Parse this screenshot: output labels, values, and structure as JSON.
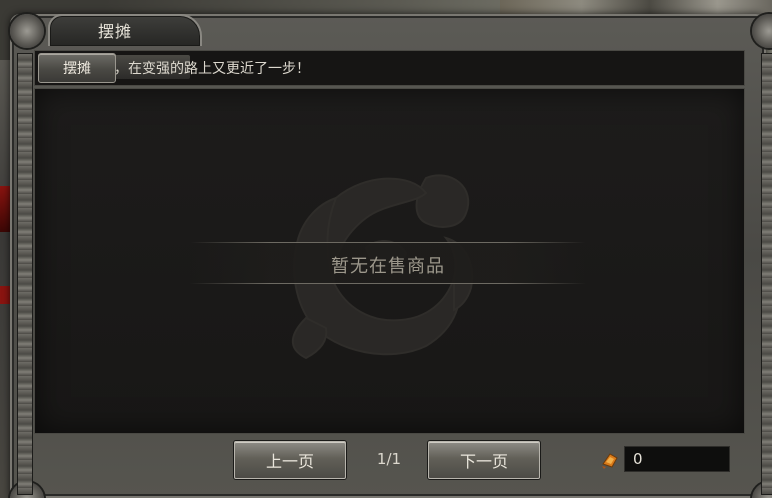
{
  "window": {
    "title": "摆摊"
  },
  "message_bar": {
    "stall_button_label": "摆摊",
    "message": "，在变强的路上又更近了一步！"
  },
  "content": {
    "empty_text": "暂无在售商品"
  },
  "pagination": {
    "prev_label": "上一页",
    "next_label": "下一页",
    "page_info": "1/1"
  },
  "currency": {
    "icon": "gold-ingot-icon",
    "value": "0"
  }
}
